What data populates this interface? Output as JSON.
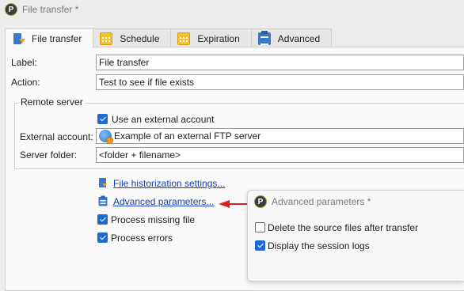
{
  "window": {
    "title": "File transfer *"
  },
  "tabs": [
    {
      "label": "File transfer",
      "icon": "file-transfer-icon"
    },
    {
      "label": "Schedule",
      "icon": "calendar-icon"
    },
    {
      "label": "Expiration",
      "icon": "calendar-icon"
    },
    {
      "label": "Advanced",
      "icon": "clipboard-icon"
    }
  ],
  "form": {
    "label_caption": "Label:",
    "label_value": "File transfer",
    "action_caption": "Action:",
    "action_value": "Test to see if file exists",
    "remote_server": {
      "title": "Remote server",
      "use_external_label": "Use an external account",
      "use_external_checked": true,
      "external_account_caption": "External account:",
      "external_account_value": "Example of an external FTP server",
      "server_folder_caption": "Server folder:",
      "server_folder_value": "<folder + filename>"
    },
    "historization_link": "File historization settings...",
    "advanced_link": "Advanced parameters...",
    "process_missing_label": "Process missing file",
    "process_missing_checked": true,
    "process_errors_label": "Process errors",
    "process_errors_checked": true
  },
  "popup": {
    "title": "Advanced parameters *",
    "delete_source_label": "Delete the source files after transfer",
    "delete_source_checked": false,
    "session_logs_label": "Display the session logs",
    "session_logs_checked": true
  },
  "colors": {
    "arrow": "#e01e1e",
    "link": "#1b3fae",
    "check": "#1f6ad0"
  }
}
